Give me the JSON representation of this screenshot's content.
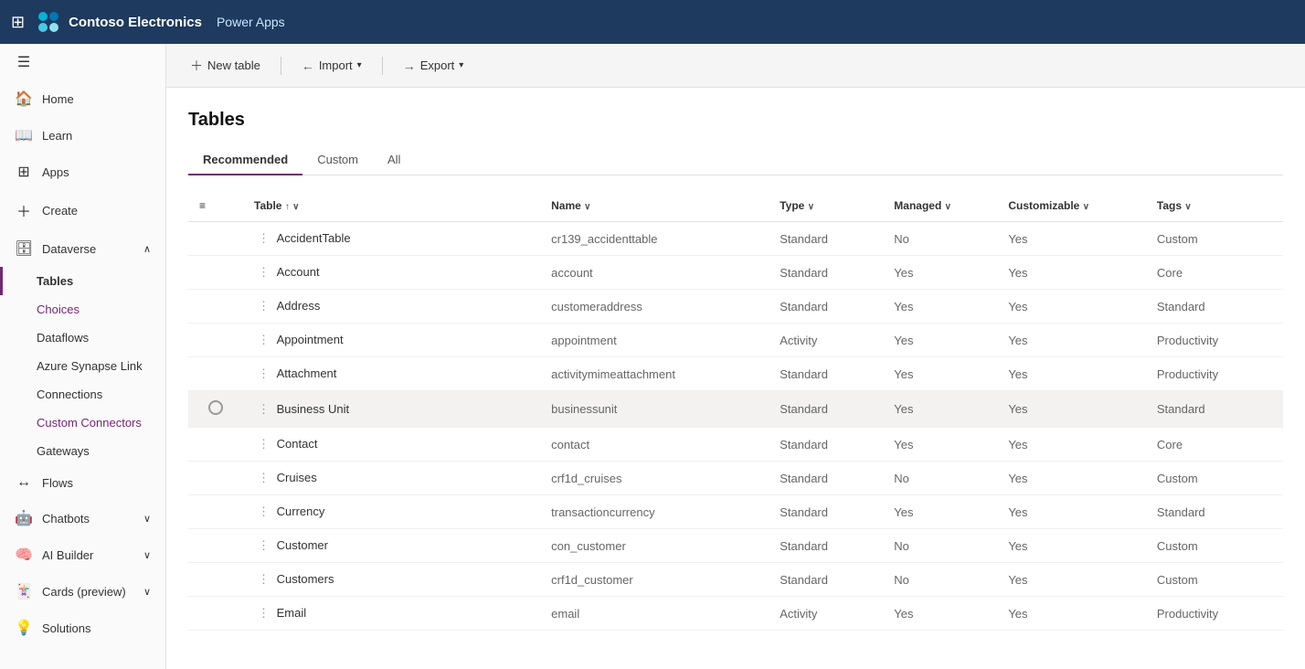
{
  "topbar": {
    "company": "Contoso Electronics",
    "app": "Power Apps"
  },
  "sidebar": {
    "items": [
      {
        "id": "home",
        "label": "Home",
        "icon": "🏠"
      },
      {
        "id": "learn",
        "label": "Learn",
        "icon": "📖"
      },
      {
        "id": "apps",
        "label": "Apps",
        "icon": "⊞"
      },
      {
        "id": "create",
        "label": "Create",
        "icon": "+"
      },
      {
        "id": "dataverse",
        "label": "Dataverse",
        "icon": "🗄",
        "expandable": true,
        "expanded": true
      },
      {
        "id": "flows",
        "label": "Flows",
        "icon": "↔"
      },
      {
        "id": "chatbots",
        "label": "Chatbots",
        "icon": "🤖",
        "expandable": true
      },
      {
        "id": "ai-builder",
        "label": "AI Builder",
        "icon": "🧠",
        "expandable": true
      },
      {
        "id": "cards",
        "label": "Cards (preview)",
        "icon": "🃏",
        "expandable": true
      },
      {
        "id": "solutions",
        "label": "Solutions",
        "icon": "💡"
      }
    ],
    "sub_items": [
      {
        "id": "tables",
        "label": "Tables",
        "active": true
      },
      {
        "id": "choices",
        "label": "Choices",
        "highlighted": true
      },
      {
        "id": "dataflows",
        "label": "Dataflows"
      },
      {
        "id": "azure-synapse",
        "label": "Azure Synapse Link"
      },
      {
        "id": "connections",
        "label": "Connections"
      },
      {
        "id": "custom-connectors",
        "label": "Custom Connectors",
        "highlighted": true
      },
      {
        "id": "gateways",
        "label": "Gateways"
      }
    ]
  },
  "toolbar": {
    "new_table_label": "New table",
    "import_label": "Import",
    "export_label": "Export"
  },
  "page": {
    "title": "Tables",
    "tabs": [
      {
        "id": "recommended",
        "label": "Recommended",
        "active": true
      },
      {
        "id": "custom",
        "label": "Custom"
      },
      {
        "id": "all",
        "label": "All"
      }
    ]
  },
  "table": {
    "columns": [
      {
        "id": "table",
        "label": "Table",
        "sortable": true,
        "sorted": "asc"
      },
      {
        "id": "name",
        "label": "Name",
        "sortable": true
      },
      {
        "id": "type",
        "label": "Type",
        "sortable": true
      },
      {
        "id": "managed",
        "label": "Managed",
        "sortable": true
      },
      {
        "id": "customizable",
        "label": "Customizable",
        "sortable": true
      },
      {
        "id": "tags",
        "label": "Tags",
        "sortable": true
      }
    ],
    "rows": [
      {
        "table": "AccidentTable",
        "name": "cr139_accidenttable",
        "type": "Standard",
        "managed": "No",
        "customizable": "Yes",
        "tags": "Custom"
      },
      {
        "table": "Account",
        "name": "account",
        "type": "Standard",
        "managed": "Yes",
        "customizable": "Yes",
        "tags": "Core"
      },
      {
        "table": "Address",
        "name": "customeraddress",
        "type": "Standard",
        "managed": "Yes",
        "customizable": "Yes",
        "tags": "Standard"
      },
      {
        "table": "Appointment",
        "name": "appointment",
        "type": "Activity",
        "managed": "Yes",
        "customizable": "Yes",
        "tags": "Productivity"
      },
      {
        "table": "Attachment",
        "name": "activitymimeattachment",
        "type": "Standard",
        "managed": "Yes",
        "customizable": "Yes",
        "tags": "Productivity"
      },
      {
        "table": "Business Unit",
        "name": "businessunit",
        "type": "Standard",
        "managed": "Yes",
        "customizable": "Yes",
        "tags": "Standard",
        "highlighted": true
      },
      {
        "table": "Contact",
        "name": "contact",
        "type": "Standard",
        "managed": "Yes",
        "customizable": "Yes",
        "tags": "Core"
      },
      {
        "table": "Cruises",
        "name": "crf1d_cruises",
        "type": "Standard",
        "managed": "No",
        "customizable": "Yes",
        "tags": "Custom"
      },
      {
        "table": "Currency",
        "name": "transactioncurrency",
        "type": "Standard",
        "managed": "Yes",
        "customizable": "Yes",
        "tags": "Standard"
      },
      {
        "table": "Customer",
        "name": "con_customer",
        "type": "Standard",
        "managed": "No",
        "customizable": "Yes",
        "tags": "Custom"
      },
      {
        "table": "Customers",
        "name": "crf1d_customer",
        "type": "Standard",
        "managed": "No",
        "customizable": "Yes",
        "tags": "Custom"
      },
      {
        "table": "Email",
        "name": "email",
        "type": "Activity",
        "managed": "Yes",
        "customizable": "Yes",
        "tags": "Productivity"
      }
    ]
  }
}
